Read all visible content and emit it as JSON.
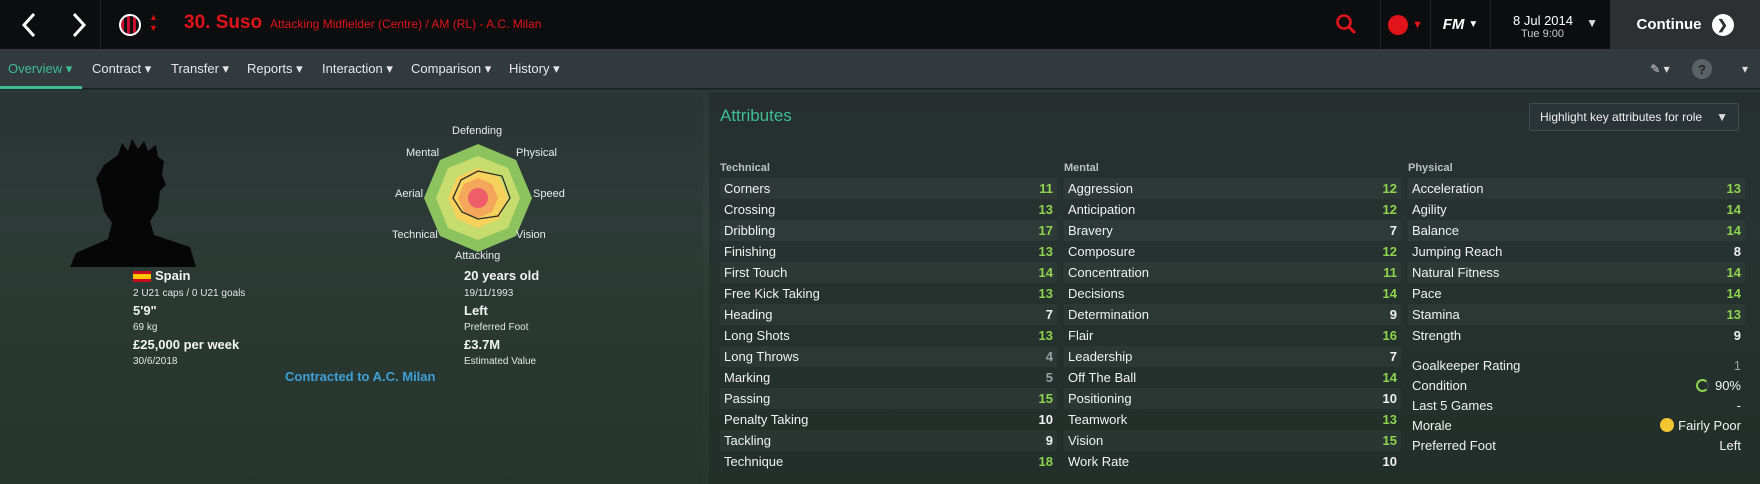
{
  "header": {
    "player_title": "30. Suso",
    "player_subtitle": "Attacking Midfielder (Centre) / AM (RL) - A.C. Milan",
    "logo_text": "FM",
    "date": "8 Jul 2014",
    "time": "Tue 9:00",
    "continue_label": "Continue"
  },
  "menu": {
    "items": [
      "Overview",
      "Contract",
      "Transfer",
      "Reports",
      "Interaction",
      "Comparison",
      "History"
    ],
    "active_index": 0,
    "help": "?"
  },
  "profile": {
    "nationality": "Spain",
    "caps": "2 U21 caps / 0 U21 goals",
    "height": "5'9\"",
    "weight": "69 kg",
    "wage": "£25,000 per week",
    "contract_end": "30/6/2018",
    "age": "20 years old",
    "dob": "19/11/1993",
    "foot": "Left",
    "foot_label": "Preferred Foot",
    "value": "£3.7M",
    "value_label": "Estimated Value",
    "contract_link": "Contracted to A.C. Milan"
  },
  "radar": {
    "labels": [
      "Defending",
      "Physical",
      "Speed",
      "Vision",
      "Attacking",
      "Technical",
      "Aerial",
      "Mental"
    ]
  },
  "attributes": {
    "title": "Attributes",
    "highlight_label": "Highlight key attributes for role",
    "technical_header": "Technical",
    "mental_header": "Mental",
    "physical_header": "Physical",
    "technical": [
      {
        "name": "Corners",
        "value": "11"
      },
      {
        "name": "Crossing",
        "value": "13"
      },
      {
        "name": "Dribbling",
        "value": "17"
      },
      {
        "name": "Finishing",
        "value": "13"
      },
      {
        "name": "First Touch",
        "value": "14"
      },
      {
        "name": "Free Kick Taking",
        "value": "13"
      },
      {
        "name": "Heading",
        "value": "7"
      },
      {
        "name": "Long Shots",
        "value": "13"
      },
      {
        "name": "Long Throws",
        "value": "4"
      },
      {
        "name": "Marking",
        "value": "5"
      },
      {
        "name": "Passing",
        "value": "15"
      },
      {
        "name": "Penalty Taking",
        "value": "10"
      },
      {
        "name": "Tackling",
        "value": "9"
      },
      {
        "name": "Technique",
        "value": "18"
      }
    ],
    "mental": [
      {
        "name": "Aggression",
        "value": "12"
      },
      {
        "name": "Anticipation",
        "value": "12"
      },
      {
        "name": "Bravery",
        "value": "7"
      },
      {
        "name": "Composure",
        "value": "12"
      },
      {
        "name": "Concentration",
        "value": "11"
      },
      {
        "name": "Decisions",
        "value": "14"
      },
      {
        "name": "Determination",
        "value": "9"
      },
      {
        "name": "Flair",
        "value": "16"
      },
      {
        "name": "Leadership",
        "value": "7"
      },
      {
        "name": "Off The Ball",
        "value": "14"
      },
      {
        "name": "Positioning",
        "value": "10"
      },
      {
        "name": "Teamwork",
        "value": "13"
      },
      {
        "name": "Vision",
        "value": "15"
      },
      {
        "name": "Work Rate",
        "value": "10"
      }
    ],
    "physical": [
      {
        "name": "Acceleration",
        "value": "13"
      },
      {
        "name": "Agility",
        "value": "14"
      },
      {
        "name": "Balance",
        "value": "14"
      },
      {
        "name": "Jumping Reach",
        "value": "8"
      },
      {
        "name": "Natural Fitness",
        "value": "14"
      },
      {
        "name": "Pace",
        "value": "14"
      },
      {
        "name": "Stamina",
        "value": "13"
      },
      {
        "name": "Strength",
        "value": "9"
      }
    ],
    "extra": [
      {
        "name": "Goalkeeper Rating",
        "value": "1"
      },
      {
        "name": "Condition",
        "value": "90%"
      },
      {
        "name": "Last 5 Games",
        "value": "-"
      },
      {
        "name": "Morale",
        "value": "Fairly Poor"
      },
      {
        "name": "Preferred Foot",
        "value": "Left"
      }
    ]
  }
}
